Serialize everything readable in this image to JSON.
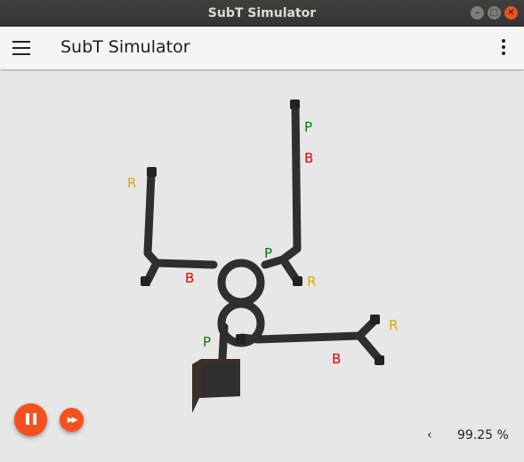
{
  "window": {
    "title": "SubT Simulator",
    "controls": [
      "minimize",
      "maximize",
      "close"
    ]
  },
  "toolbar": {
    "menu_icon": "hamburger-menu-icon",
    "title": "SubT Simulator",
    "overflow_icon": "more-vert-icon"
  },
  "scene": {
    "markers": [
      {
        "label": "P",
        "color": "#008000"
      },
      {
        "label": "B",
        "color": "#e00000"
      },
      {
        "label": "R",
        "color": "#e0a800"
      },
      {
        "label": "P",
        "color": "#008000"
      },
      {
        "label": "B",
        "color": "#e00000"
      },
      {
        "label": "R",
        "color": "#e0a800"
      },
      {
        "label": "P",
        "color": "#008000"
      },
      {
        "label": "R",
        "color": "#e0a800"
      },
      {
        "label": "B",
        "color": "#e00000"
      }
    ]
  },
  "playback": {
    "pause_icon": "pause-icon",
    "fast_forward_icon": "fast-forward-icon",
    "accent_color": "#f4511e"
  },
  "status": {
    "prev_glyph": "‹",
    "rtf_percent": "99.25 %"
  }
}
